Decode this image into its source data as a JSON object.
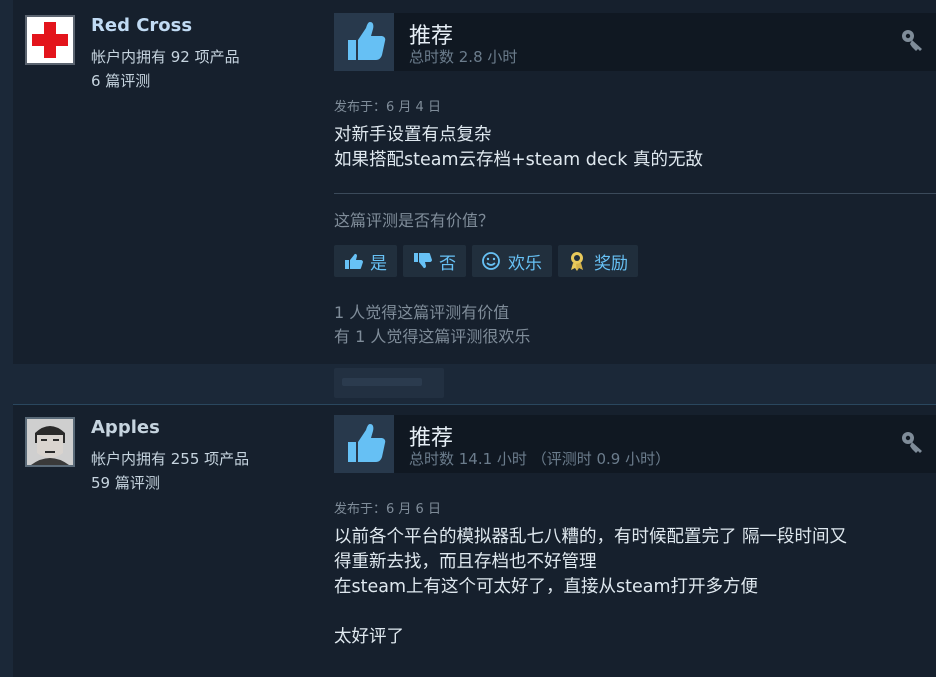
{
  "reviews": [
    {
      "author": "Red Cross",
      "products": "帐户内拥有 92 项产品",
      "reviews_count": "6 篇评测",
      "avatar_icon": "red-cross-avatar",
      "recommendation": "推荐",
      "hours": "总时数 2.8 小时",
      "posted": "发布于：6 月 4 日",
      "body": "对新手设置有点复杂\n如果搭配steam云存档+steam deck 真的无敌",
      "helpful_question": "这篇评测是否有价值？",
      "buttons": {
        "yes": "是",
        "no": "否",
        "funny": "欢乐",
        "award": "奖励"
      },
      "stats": [
        "1 人觉得这篇评测有价值",
        "有 1 人觉得这篇评测很欢乐"
      ]
    },
    {
      "author": "Apples",
      "products": "帐户内拥有 255 项产品",
      "reviews_count": "59 篇评测",
      "avatar_icon": "cartoon-face-avatar",
      "recommendation": "推荐",
      "hours": "总时数 14.1 小时 （评测时 0.9 小时）",
      "posted": "发布于：6 月 6 日",
      "body": "以前各个平台的模拟器乱七八糟的，有时候配置完了 隔一段时间又\n得重新去找，而且存档也不好管理\n在steam上有这个可太好了，直接从steam打开多方便\n\n太好评了"
    }
  ],
  "colors": {
    "background": "#1b2838",
    "panel": "#16202d",
    "link_blue": "#67c1f5",
    "thumb_blue": "#66c0f4"
  }
}
